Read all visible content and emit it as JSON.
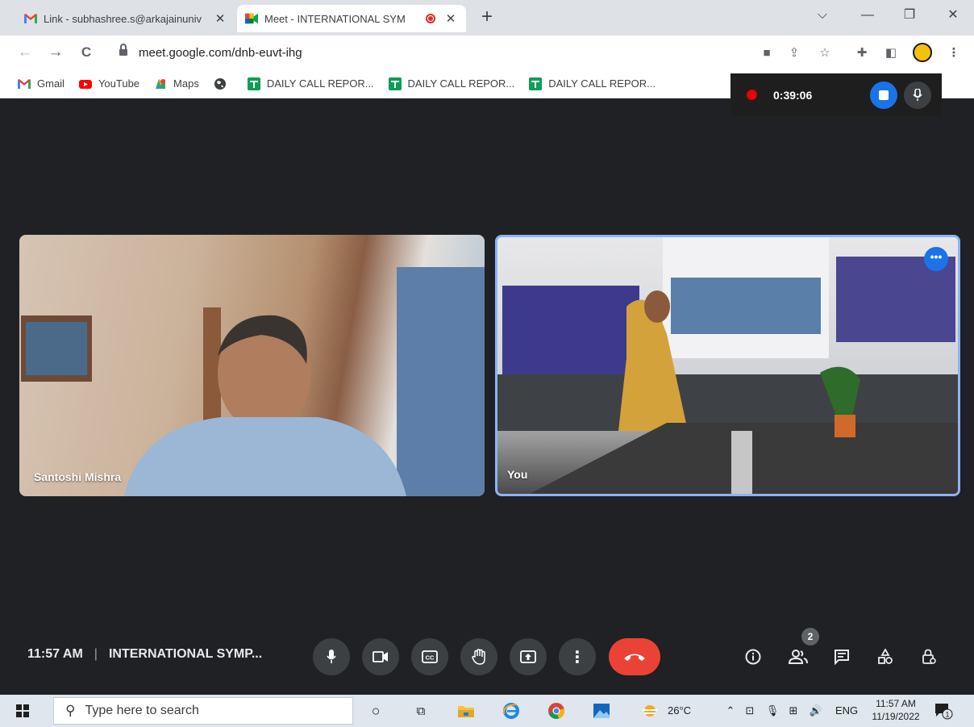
{
  "browser": {
    "tabs": [
      {
        "title": "Link - subhashree.s@arkajainuniv",
        "favicon": "gmail-icon",
        "active": false
      },
      {
        "title": "Meet - INTERNATIONAL SYM",
        "favicon": "google-meet-icon",
        "active": true
      }
    ],
    "url": "meet.google.com/dnb-euvt-ihg",
    "bookmarks": [
      {
        "label": "Gmail",
        "icon": "gmail-icon"
      },
      {
        "label": "YouTube",
        "icon": "youtube-icon"
      },
      {
        "label": "Maps",
        "icon": "maps-icon"
      },
      {
        "label": "",
        "icon": "globe-icon"
      },
      {
        "label": "DAILY CALL REPOR...",
        "icon": "sheets-icon"
      },
      {
        "label": "DAILY CALL REPOR...",
        "icon": "sheets-icon"
      },
      {
        "label": "DAILY CALL REPOR...",
        "icon": "sheets-icon"
      }
    ]
  },
  "recording": {
    "elapsed": "0:39:06"
  },
  "participants": {
    "remote_name": "Santoshi Mishra",
    "local_name": "You",
    "count": "2"
  },
  "meeting": {
    "time": "11:57 AM",
    "title": "INTERNATIONAL SYMP..."
  },
  "taskbar": {
    "search_placeholder": "Type here to search",
    "weather": "26°C",
    "language": "ENG",
    "clock_time": "11:57 AM",
    "clock_date": "11/19/2022",
    "notification_count": "1"
  },
  "colors": {
    "meet_background": "#202124",
    "end_call": "#ea4335",
    "accent_blue": "#1a73e8",
    "active_tile_border": "#8ab4f8"
  }
}
